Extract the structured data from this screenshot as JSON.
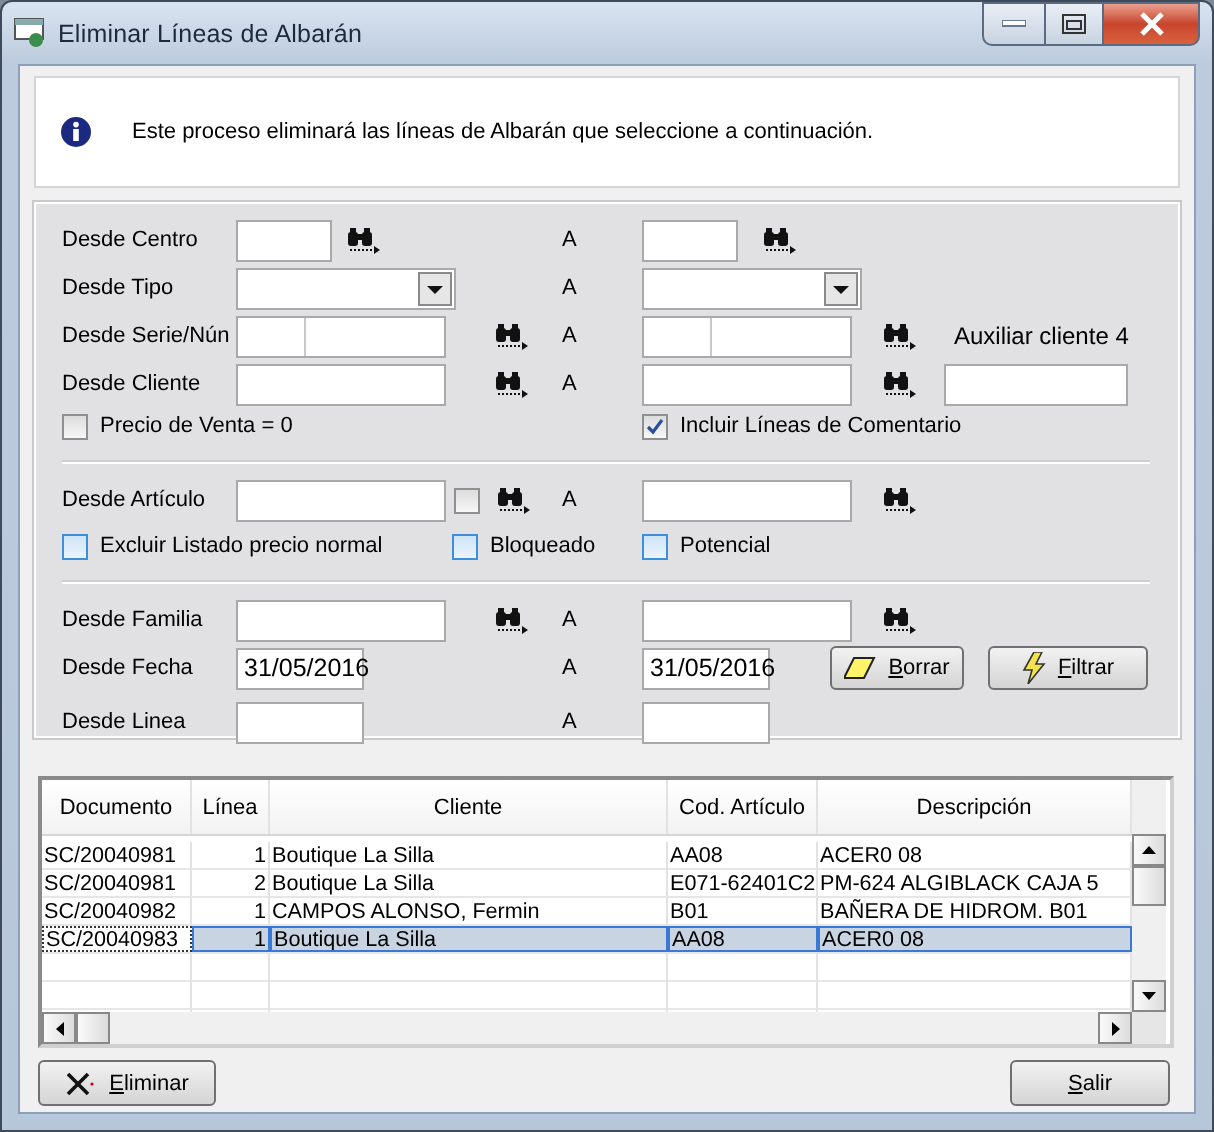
{
  "window": {
    "title": "Eliminar Líneas de Albarán"
  },
  "info": {
    "message": "Este proceso eliminará las líneas de Albarán que seleccione a continuación."
  },
  "filters": [
    {
      "kind": "code",
      "label": "Desde Centro",
      "to_label": "A"
    },
    {
      "kind": "dropdown",
      "label": "Desde Tipo",
      "to_label": "A"
    },
    {
      "kind": "split",
      "label": "Desde Serie/Nún",
      "to_label": "A",
      "extra_label": "Auxiliar cliente 4"
    },
    {
      "kind": "search",
      "label": "Desde Cliente",
      "to_label": "A",
      "aux_field": true
    },
    {
      "kind": "options",
      "options": [
        {
          "label": "Precio de Venta = 0",
          "checked": false
        },
        {
          "label": "Incluir Líneas de Comentario",
          "checked": true
        }
      ]
    },
    {
      "kind": "divider"
    },
    {
      "kind": "search",
      "label": "Desde Artículo",
      "to_label": "A",
      "inner_check": {
        "checked": false
      }
    },
    {
      "kind": "accent_options",
      "options": [
        {
          "label": "Excluir Listado precio normal",
          "checked": false
        },
        {
          "label": "Bloqueado",
          "checked": false
        },
        {
          "label": "Potencial",
          "checked": false
        }
      ]
    },
    {
      "kind": "divider"
    },
    {
      "kind": "search",
      "label": "Desde Familia",
      "to_label": "A"
    },
    {
      "kind": "date",
      "label": "Desde Fecha",
      "to_label": "A",
      "from_value": "31/05/2016",
      "to_value": "31/05/2016",
      "buttons": [
        {
          "kind": "clear",
          "label": "Borrar"
        },
        {
          "kind": "filter",
          "label": "Filtrar"
        }
      ]
    },
    {
      "kind": "plain",
      "label": "Desde Linea",
      "to_label": "A"
    }
  ],
  "table": {
    "columns": [
      "Documento",
      "Línea",
      "Cliente",
      "Cod. Artículo",
      "Descripción"
    ],
    "rows": [
      {
        "cells": [
          "SC/20040981",
          "1",
          "Boutique La Silla",
          "AA08",
          "ACER0 08"
        ],
        "selected": false
      },
      {
        "cells": [
          "SC/20040981",
          "2",
          "Boutique La Silla",
          "E071-62401C2",
          "PM-624 ALGIBLACK CAJA 5"
        ],
        "selected": false
      },
      {
        "cells": [
          "SC/20040982",
          "1",
          "CAMPOS ALONSO, Fermin",
          "B01",
          "BAÑERA DE HIDROM. B01"
        ],
        "selected": false
      },
      {
        "cells": [
          "SC/20040983",
          "1",
          "Boutique La Silla",
          "AA08",
          "ACER0 08"
        ],
        "selected": true
      }
    ]
  },
  "footer": {
    "buttons": [
      {
        "kind": "delete",
        "label": "Eliminar"
      },
      {
        "kind": "exit",
        "label": "Salir"
      }
    ]
  }
}
